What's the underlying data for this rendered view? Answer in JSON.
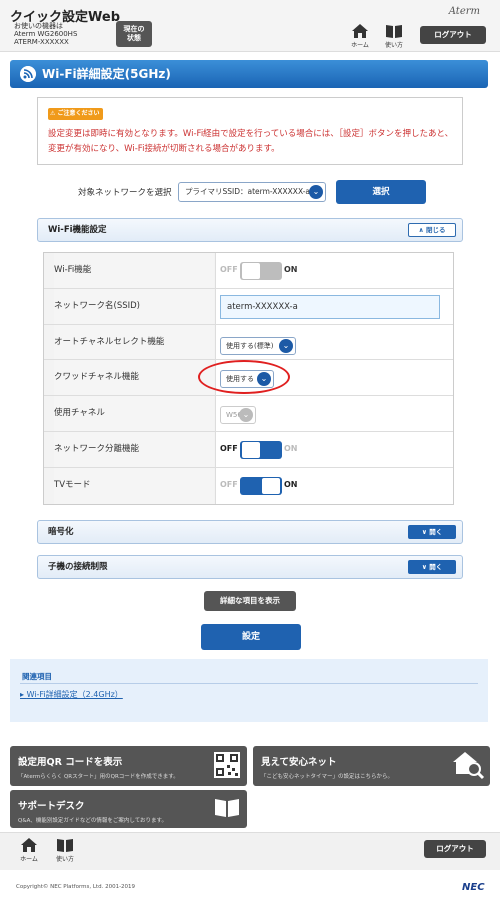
{
  "header": {
    "app_title": "クイック設定Web",
    "device_label": "お使いの機器は",
    "device_model": "Aterm WG2600HS",
    "device_id": "ATERM-XXXXXX",
    "status_button": [
      "現在の",
      "状態"
    ],
    "brand": "Aterm",
    "home_label": "ホーム",
    "manual_label": "使い方",
    "logout_label": "ログアウト"
  },
  "page": {
    "title": "Wi-Fi詳細設定(5GHz)"
  },
  "notice": {
    "badge": "ご注意ください",
    "text": "設定変更は即時に有効となります。Wi-Fi経由で設定を行っている場合には、［設定］ボタンを押したあと、変更が有効になり、Wi-Fi接続が切断される場合があります。"
  },
  "network_select": {
    "label": "対象ネットワークを選択",
    "value": "プライマリSSID：aterm-XXXXXX-a",
    "button": "選択"
  },
  "wifi_section": {
    "title": "Wi-Fi機能設定",
    "toggle": "閉じる",
    "rows": [
      {
        "label": "Wi-Fi機能",
        "type": "switch",
        "off": "OFF",
        "on": "ON",
        "state": "on",
        "disabled": true
      },
      {
        "label": "ネットワーク名(SSID)",
        "type": "text",
        "value": "aterm-XXXXXX-a"
      },
      {
        "label": "オートチャネルセレクト機能",
        "type": "select",
        "value": "使用する(標準)"
      },
      {
        "label": "クワッドチャネル機能",
        "type": "select",
        "value": "使用する"
      },
      {
        "label": "使用チャネル",
        "type": "select",
        "value": "W56",
        "disabled": true
      },
      {
        "label": "ネットワーク分離機能",
        "type": "switch",
        "off": "OFF",
        "on": "ON",
        "state": "off"
      },
      {
        "label": "TVモード",
        "type": "switch",
        "off": "OFF",
        "on": "ON",
        "state": "on"
      }
    ]
  },
  "encryption_section": {
    "title": "暗号化",
    "toggle": "開く"
  },
  "access_section": {
    "title": "子機の接続制限",
    "toggle": "開く"
  },
  "buttons": {
    "detail": "詳細な項目を表示",
    "set": "設定"
  },
  "related": {
    "title": "関連項目",
    "link": "Wi-Fi詳細設定（2.4GHz）"
  },
  "cards": {
    "qr_title": "設定用QR コードを表示",
    "qr_desc": "「Atermらくらく QRスタート」用のQRコードを作成できます。",
    "safe_title": "見えて安心ネット",
    "safe_desc": "「こども安心ネットタイマー」の設定はこちらから。",
    "support_title": "サポートデスク",
    "support_desc": "Q&A、機能別設定ガイドなどの情報をご案内しております。"
  },
  "footer": {
    "home_label": "ホーム",
    "manual_label": "使い方",
    "logout_label": "ログアウト",
    "copyright": "Copyright© NEC Platforms, Ltd. 2001-2019",
    "logo": "NEC"
  },
  "colors": {
    "primary": "#1f62b0",
    "warning_text": "#cc3333",
    "dark_button": "#555555",
    "highlight_circle": "#e02020"
  }
}
